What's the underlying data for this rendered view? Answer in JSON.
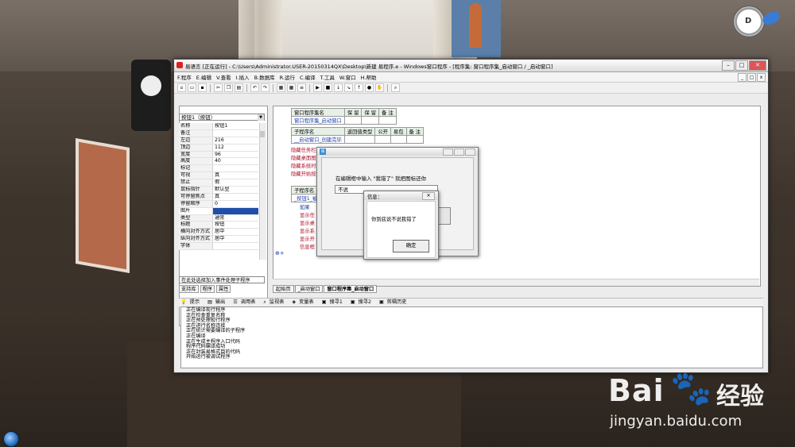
{
  "ide": {
    "title": "易语言 [正在运行] - C:\\Users\\Administrator.USER-20150314QX\\Desktop\\新建 易程序.e - Windows窗口程序 - [程序集: 窗口程序集_启动窗口 / _启动窗口]",
    "menu": [
      "F.程序",
      "E.编辑",
      "V.查看",
      "I.插入",
      "B.数据库",
      "R.运行",
      "C.编译",
      "T.工具",
      "W.窗口",
      "H.帮助"
    ]
  },
  "left": {
    "selector": "按钮1（按钮）",
    "props": [
      {
        "k": "名称",
        "v": "按钮1"
      },
      {
        "k": "备注",
        "v": ""
      },
      {
        "k": "左边",
        "v": "216"
      },
      {
        "k": "顶边",
        "v": "112"
      },
      {
        "k": "宽度",
        "v": "96"
      },
      {
        "k": "高度",
        "v": "40"
      },
      {
        "k": "标记",
        "v": ""
      },
      {
        "k": "可视",
        "v": "真"
      },
      {
        "k": "禁止",
        "v": "假"
      },
      {
        "k": "鼠标指针",
        "v": "默认型"
      },
      {
        "k": "可停留焦点",
        "v": "真"
      },
      {
        "k": "停留顺序",
        "v": "0"
      },
      {
        "k": "图片",
        "v": ""
      },
      {
        "k": "类型",
        "v": "通常"
      },
      {
        "k": "标题",
        "v": "按钮"
      },
      {
        "k": "横向对齐方式",
        "v": "居中"
      },
      {
        "k": "纵向对齐方式",
        "v": "居中"
      },
      {
        "k": "字体",
        "v": ""
      }
    ],
    "event_combo": "在此处选择加入事件处理子程序",
    "tabs": [
      "支持库",
      "程序",
      "属性"
    ]
  },
  "editor": {
    "assembly_header": [
      "窗口程序集名",
      "保 留",
      "保 留",
      "备 注"
    ],
    "assembly_name": "窗口程序集_启动窗口",
    "sub_header": [
      "子程序名",
      "返回值类型",
      "公开",
      "易包",
      "备 注"
    ],
    "sub1_name": "__启动窗口_创建完毕",
    "lines_red": [
      "隐藏任务栏",
      "隐藏桌面图",
      "隐藏系统时",
      "隐藏开始按"
    ],
    "sub2_name": "_按钮1_被单",
    "if_line": "如果",
    "lines_red2": [
      "显示任",
      "显示桌",
      "显示系",
      "显示开",
      "信息框"
    ],
    "tabs": [
      "起始页",
      "_启动窗口",
      "窗口程序集_启动窗口"
    ]
  },
  "bottom": {
    "tabs": [
      "提示",
      "输出",
      "调用表",
      "监视表",
      "变量表",
      "搜寻1",
      "搜寻2",
      "剪辑历史"
    ],
    "output": [
      "正在编译现行程序",
      "正在检查重复名称",
      "正在预处理现行程序",
      "正在进行名称连接",
      "正在统计需要编译的子程序",
      "正在编译",
      "正在生成主程序入口代码",
      "程序代码编译成功",
      "正在封装易格式目的代码",
      "开始运行被调试程序"
    ]
  },
  "dialog1": {
    "prompt": "在编辑框中输入 \"我错了\" 就把图标还你",
    "input_value": "不说"
  },
  "dialog2": {
    "title": "信息：",
    "message": "你到底说不说我错了",
    "ok": "确定"
  },
  "watermark": {
    "logo": "Bai",
    "paw": "du",
    "sub": "经验",
    "url": "jingyan.baidu.com"
  },
  "gadget": {
    "clock_letter": "D"
  }
}
